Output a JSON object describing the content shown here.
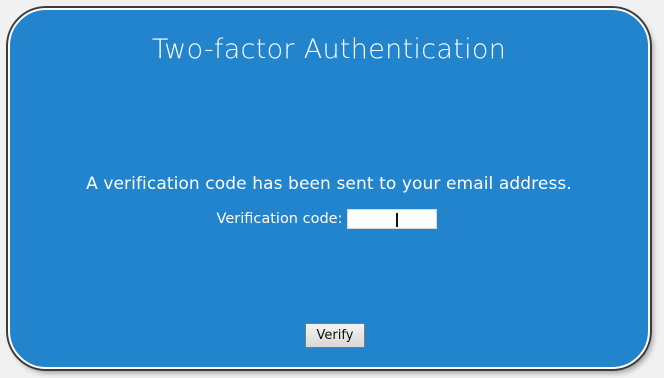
{
  "dialog": {
    "title": "Two-factor Authentication",
    "message": "A verification code has been sent to your email address.",
    "code_label": "Verification code:",
    "code_value": "",
    "verify_label": "Verify",
    "colors": {
      "panel": "#2284cc",
      "text": "#ffffff",
      "page_background": "#f1f1f1"
    }
  }
}
